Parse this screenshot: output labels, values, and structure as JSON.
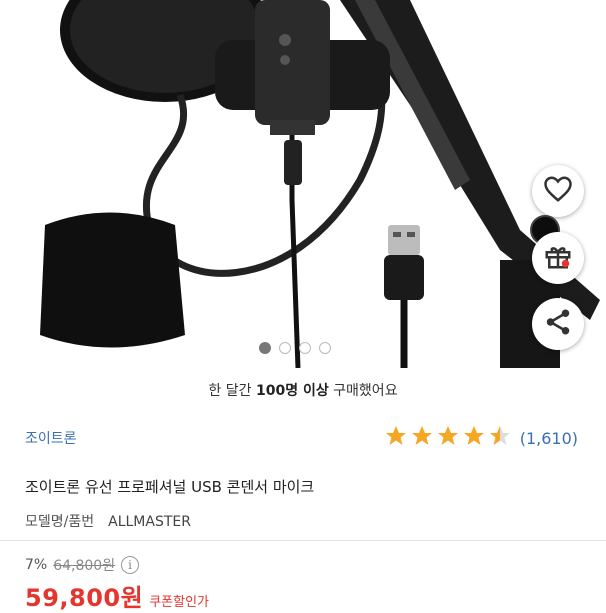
{
  "purchase_note": {
    "prefix": "한 달간 ",
    "highlight": "100명 이상",
    "suffix": " 구매했어요"
  },
  "brand": "조이트론",
  "rating": {
    "stars": 4.5,
    "count": "(1,610)"
  },
  "product_title": "조이트론 유선 프로페셔널 USB 콘덴서 마이크",
  "model": {
    "label": "모델명/품번",
    "value": "ALLMASTER"
  },
  "pricing": {
    "discount": "7%",
    "original_price": "64,800원",
    "info_symbol": "i",
    "price": "59,800원",
    "coupon_label": "쿠폰할인가"
  },
  "carousel": {
    "total": 4,
    "active": 0
  },
  "colors": {
    "accent_blue": "#3a6fb5",
    "price_red": "#e4362e",
    "star": "#f5a623"
  },
  "icons": {
    "wishlist": "heart-icon",
    "gift": "gift-icon",
    "share": "share-icon"
  }
}
